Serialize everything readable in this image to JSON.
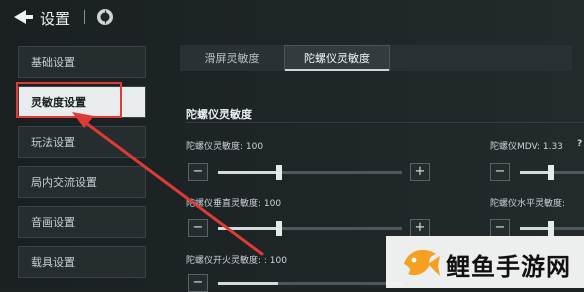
{
  "header": {
    "title": "设置"
  },
  "sidebar": {
    "items": [
      {
        "label": "基础设置"
      },
      {
        "label": "灵敏度设置"
      },
      {
        "label": "玩法设置"
      },
      {
        "label": "局内交流设置"
      },
      {
        "label": "音画设置"
      },
      {
        "label": "载具设置"
      }
    ]
  },
  "tabs": [
    {
      "label": "滑屏灵敏度"
    },
    {
      "label": "陀螺仪灵敏度"
    }
  ],
  "section": {
    "title": "陀螺仪灵敏度"
  },
  "settings": [
    {
      "label": "陀螺仪灵敏度: 100",
      "value": 100
    },
    {
      "label": "陀螺仪垂直灵敏度: 100",
      "value": 100
    },
    {
      "label": "陀螺仪开火灵敏度: : 100",
      "value": 100
    },
    {
      "label": "陀螺仪MDV: 1.33"
    },
    {
      "label": "陀螺仪水平灵敏度:"
    }
  ],
  "buttons": {
    "minus": "−",
    "plus": "+",
    "help": "?"
  },
  "watermark": {
    "text": "鲤鱼手游网"
  },
  "colors": {
    "annotation": "#e03a37",
    "watermark_orange": "#f5a020"
  }
}
